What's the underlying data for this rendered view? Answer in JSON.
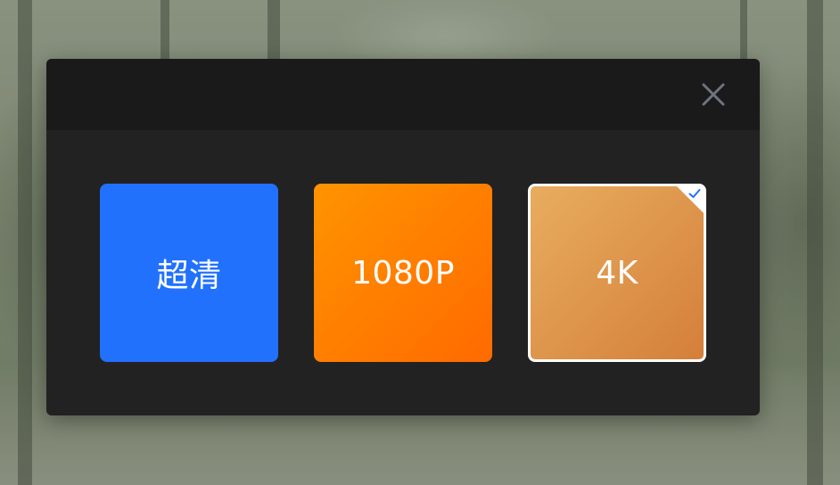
{
  "dialog": {
    "close_icon": "close-icon",
    "options": [
      {
        "label": "超清",
        "color": "#2171fd",
        "selected": false
      },
      {
        "label": "1080P",
        "color": "#ff7f00",
        "selected": false
      },
      {
        "label": "4K",
        "color": "#dd9a4f",
        "selected": true,
        "selected_icon": "check-icon"
      }
    ]
  },
  "colors": {
    "dialog_bg": "#222222",
    "header_bg": "#1a1a1a",
    "selected_border": "#ffffff",
    "check": "#2171fd"
  }
}
